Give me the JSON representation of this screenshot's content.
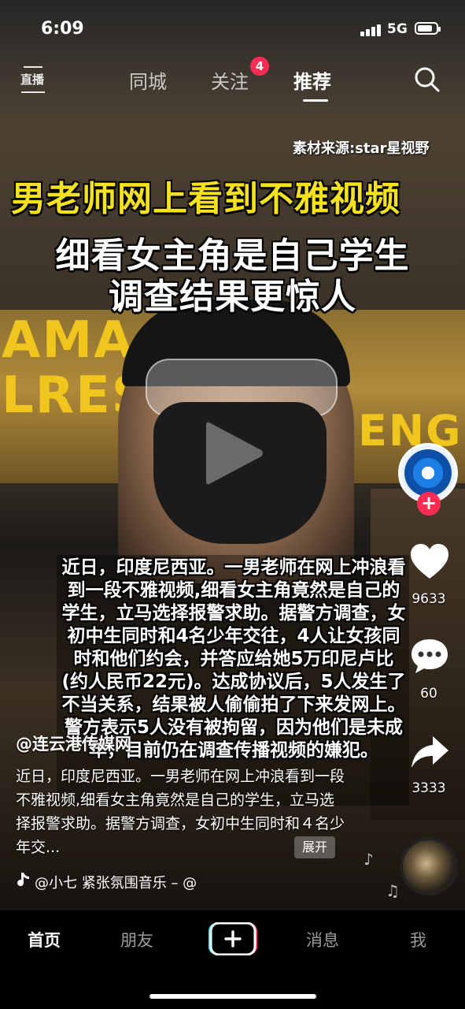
{
  "status": {
    "time": "6:09",
    "network": "5G",
    "battery_level": 0.8
  },
  "topnav": {
    "live_label": "直播",
    "tabs": [
      {
        "label": "同城"
      },
      {
        "label": "关注",
        "badge": "4"
      },
      {
        "label": "推荐",
        "active": true
      }
    ]
  },
  "video": {
    "source": "素材来源:star星视野",
    "headline_1": "男老师网上看到不雅视频",
    "headline_2": "细看女主角是自己学生",
    "headline_3": "调查结果更惊人",
    "sign_text_1": "AMA",
    "sign_text_2": "LRES",
    "sign_text_3": "ENG",
    "story": "近日，印度尼西亚。一男老师在网上冲浪看到一段不雅视频,细看女主角竟然是自己的学生，立马选择报警求助。据警方调查，女初中生同时和4名少年交往，4人让女孩同时和他们约会，并答应给她5万印尼卢比(约人民币22元)。达成协议后，5人发生了不当关系，结果被人偷偷拍了下来发网上。警方表示5人没有被拘留，因为他们是未成年，目前仍在调查传播视频的嫌犯。"
  },
  "rail": {
    "likes": "9633",
    "comments": "60",
    "shares": "3333"
  },
  "info": {
    "author": "@连云港传媒网",
    "description": "近日，印度尼西亚。一男老师在网上冲浪看到一段不雅视频,细看女主角竟然是自己的学生，立马选择报警求助。据警方调查，女初中生同时和４名少年交...",
    "expand_label": "展开",
    "music": "@小七    紧张氛围音乐 – @"
  },
  "bottom_nav": {
    "tabs": [
      {
        "label": "首页",
        "active": true
      },
      {
        "label": "朋友"
      },
      {
        "label": "消息"
      },
      {
        "label": "我"
      }
    ]
  },
  "colors": {
    "accent": "#fe2c55",
    "headline_yellow": "#f5e11e",
    "sign_yellow": "#f0c51e"
  }
}
